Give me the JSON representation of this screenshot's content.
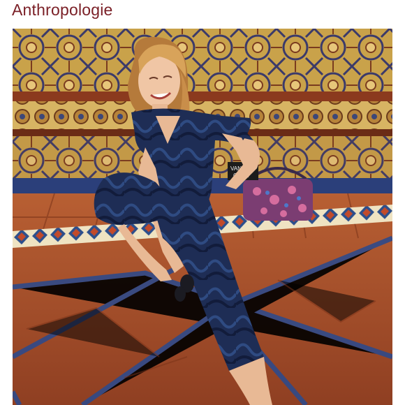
{
  "header": {
    "brand_name": "Anthropologie"
  },
  "photo": {
    "subject": "model-in-blue-velvet-jumpsuit",
    "bag_print_text": "VANO\nCILLA"
  },
  "colors": {
    "brand": "#7a1f26",
    "tile_terracotta": "#b25a34",
    "grout_blue": "#2f4a8a",
    "mosaic_gold": "#c9a24a",
    "jumpsuit_navy": "#1e2d55",
    "hair_blonde": "#c98e4a"
  }
}
